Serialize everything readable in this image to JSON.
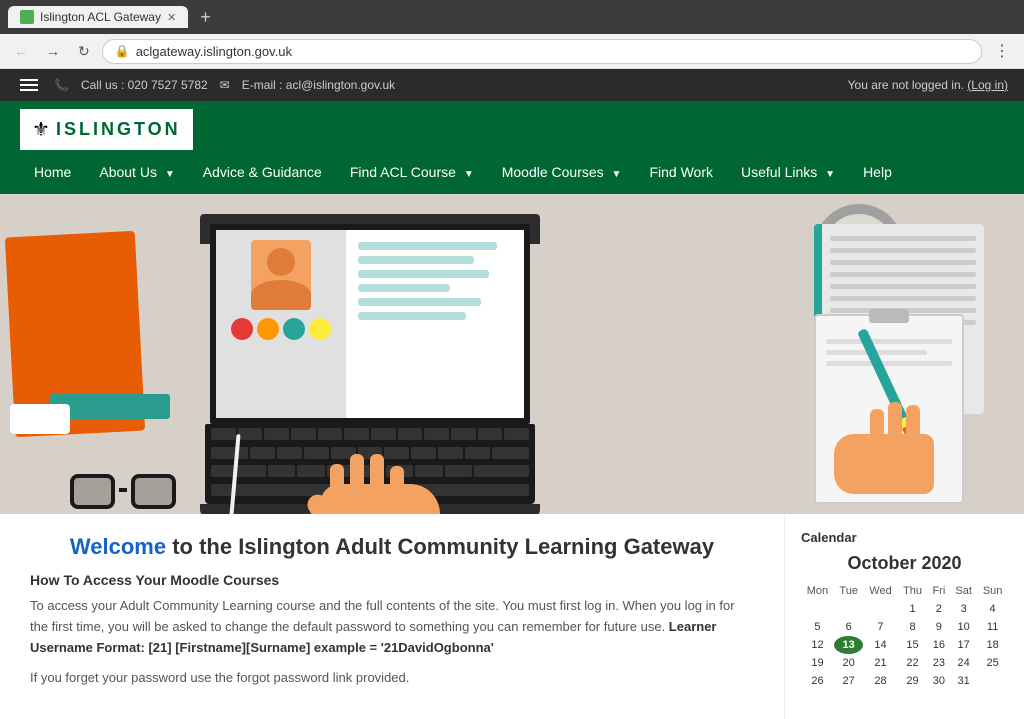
{
  "browser": {
    "tab_title": "Islington ACL Gateway",
    "url": "aclgateway.islington.gov.uk",
    "new_tab_label": "+"
  },
  "topbar": {
    "phone_icon": "📞",
    "phone": "Call us : 020 7527 5782",
    "email_icon": "✉",
    "email": "E-mail : acl@islington.gov.uk",
    "login_text": "You are not logged in.",
    "login_link": "Log in"
  },
  "nav": {
    "home": "Home",
    "about_us": "About Us",
    "advice_guidance": "Advice & Guidance",
    "find_acl_course": "Find ACL Course",
    "moodle_courses": "Moodle Courses",
    "find_work": "Find Work",
    "useful_links": "Useful Links",
    "help": "Help"
  },
  "logo": {
    "text": "ISLINGTON"
  },
  "content": {
    "welcome_prefix": "Welcome",
    "welcome_rest": " to the Islington Adult Community Learning Gateway",
    "subtitle": "How To Access Your Moodle Courses",
    "body1": "To access your Adult Community Learning course and the full contents of the site. You must first log in. When you log in for the first time, you will be asked to change the default password to something you can remember for future use.",
    "body1_strong": "Learner Username Format: [21] [Firstname][Surname] example = '21DavidOgbonna'",
    "body2": "If you forget your password use the forgot password link provided."
  },
  "calendar": {
    "title": "Calendar",
    "month_year": "October 2020",
    "headers": [
      "Mon",
      "Tue",
      "Wed",
      "Thu",
      "Fri",
      "Sat",
      "Sun"
    ],
    "weeks": [
      [
        "",
        "",
        "",
        "1",
        "2",
        "3",
        "4"
      ],
      [
        "5",
        "6",
        "7",
        "8",
        "9",
        "10",
        "11"
      ],
      [
        "12",
        "13",
        "14",
        "15",
        "16",
        "17",
        "18"
      ],
      [
        "19",
        "20",
        "21",
        "22",
        "23",
        "24",
        "25"
      ],
      [
        "26",
        "27",
        "28",
        "29",
        "30",
        "31",
        ""
      ]
    ],
    "today": "13"
  }
}
